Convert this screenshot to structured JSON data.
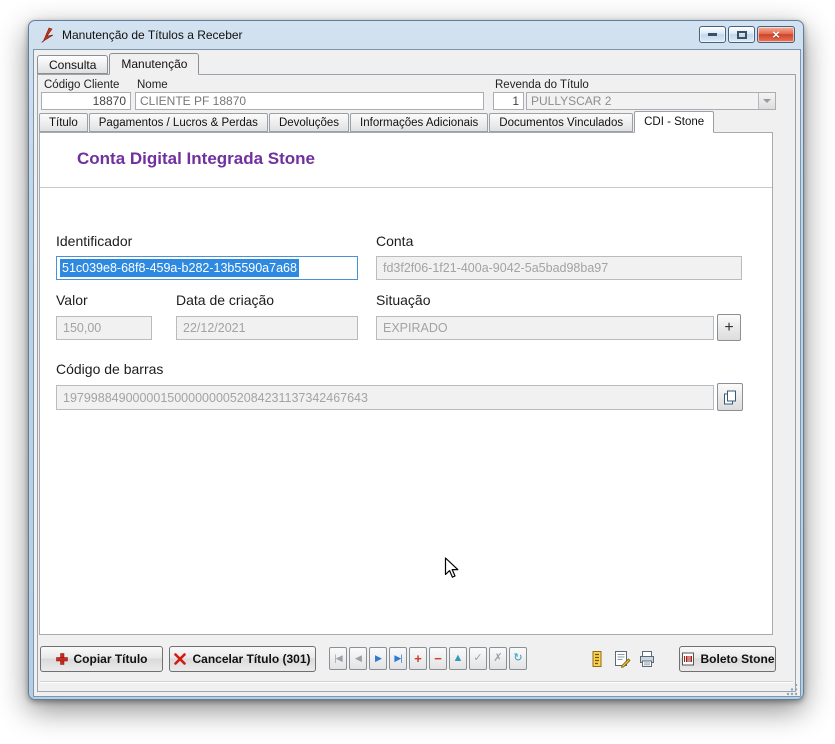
{
  "window": {
    "title": "Manutenção de Títulos a Receber"
  },
  "main_tabs": [
    {
      "label": "Consulta",
      "active": false
    },
    {
      "label": "Manutenção",
      "active": true
    }
  ],
  "header": {
    "codigo_cliente": {
      "label": "Código Cliente",
      "value": "18870"
    },
    "nome": {
      "label": "Nome",
      "value": "CLIENTE PF 18870"
    },
    "revenda": {
      "label": "Revenda do Título",
      "numero": "1",
      "nome": "PULLYSCAR 2"
    }
  },
  "sub_tabs": [
    {
      "label": "Título",
      "active": false
    },
    {
      "label": "Pagamentos / Lucros & Perdas",
      "active": false
    },
    {
      "label": "Devoluções",
      "active": false
    },
    {
      "label": "Informações Adicionais",
      "active": false
    },
    {
      "label": "Documentos Vinculados",
      "active": false
    },
    {
      "label": "CDI - Stone",
      "active": true
    }
  ],
  "stone": {
    "heading": "Conta Digital Integrada Stone",
    "identificador": {
      "label": "Identificador",
      "value": "51c039e8-68f8-459a-b282-13b5590a7a68"
    },
    "conta": {
      "label": "Conta",
      "value": "fd3f2f06-1f21-400a-9042-5a5bad98ba97"
    },
    "valor": {
      "label": "Valor",
      "value": "150,00"
    },
    "data_criacao": {
      "label": "Data de criação",
      "value": "22/12/2021"
    },
    "situacao": {
      "label": "Situação",
      "value": "EXPIRADO",
      "add_glyph": "+"
    },
    "codigo_barras": {
      "label": "Código de barras",
      "value": "19799884900000150000000052084231137342467643"
    }
  },
  "toolbar": {
    "copiar": "Copiar Título",
    "cancelar": "Cancelar Título (301)",
    "boleto": "Boleto Stone",
    "navigator": [
      {
        "name": "first",
        "glyph": "|◀",
        "state": "disabled"
      },
      {
        "name": "prior",
        "glyph": "◀",
        "state": "disabled"
      },
      {
        "name": "next",
        "glyph": "▶",
        "state": "enabled"
      },
      {
        "name": "last",
        "glyph": "▶|",
        "state": "enabled"
      },
      {
        "name": "insert",
        "glyph": "+",
        "state": "enabled"
      },
      {
        "name": "delete",
        "glyph": "−",
        "state": "enabled"
      },
      {
        "name": "edit",
        "glyph": "▲",
        "state": "enabled"
      },
      {
        "name": "post",
        "glyph": "✓",
        "state": "disabled"
      },
      {
        "name": "cancel",
        "glyph": "✗",
        "state": "disabled"
      },
      {
        "name": "refresh",
        "glyph": "↻",
        "state": "enabled"
      }
    ]
  },
  "icons": {
    "app-icon": "red-lightning",
    "minimize-icon": "bar",
    "maximize-icon": "square",
    "close-icon": "×",
    "combo-arrow-icon": "down-triangle",
    "copy-plus-icon": "red-cross",
    "cancel-x-icon": "red-x",
    "situacao-add-icon": "+",
    "copy-icon": "overlapping-sheets",
    "notepad-icon": "yellow-notepad",
    "document-edit-icon": "document-with-pencil",
    "printer-icon": "printer",
    "boleto-icon": "barcode-document",
    "resize-grip-icon": "diagonal-dots",
    "mouse-cursor-icon": "arrow-pointer"
  },
  "colors": {
    "heading_purple": "#7030a0",
    "selection_blue": "#2e8ae0",
    "close_button_red": "#cf4426",
    "frame_blue": "#bdd3e8",
    "disabled_text": "#a3a3a3"
  }
}
